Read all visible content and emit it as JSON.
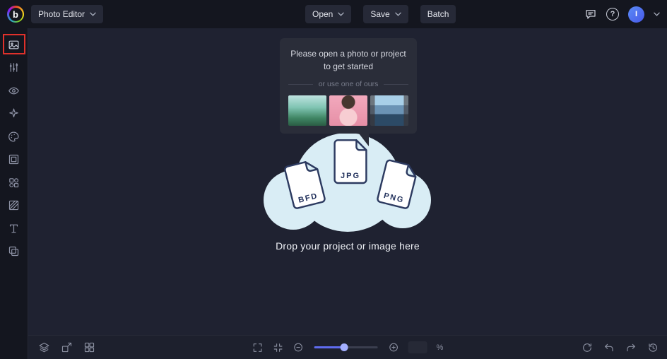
{
  "topbar": {
    "logo_letter": "b",
    "app_menu_label": "Photo Editor",
    "open_label": "Open",
    "save_label": "Save",
    "batch_label": "Batch",
    "help_glyph": "?",
    "avatar_initial": "I"
  },
  "sidebar": {
    "items": [
      {
        "icon": "image-icon"
      },
      {
        "icon": "adjust-icon"
      },
      {
        "icon": "eye-icon"
      },
      {
        "icon": "effects-icon"
      },
      {
        "icon": "palette-icon"
      },
      {
        "icon": "frame-icon"
      },
      {
        "icon": "overlays-icon"
      },
      {
        "icon": "texture-icon"
      },
      {
        "icon": "text-icon"
      },
      {
        "icon": "graphics-icon"
      }
    ]
  },
  "popover": {
    "title": "Please open a photo or project to get started",
    "divider_label": "or use one of ours",
    "thumbnails": [
      {
        "name": "van-sample-photo"
      },
      {
        "name": "portrait-sample-photo"
      },
      {
        "name": "canal-sample-photo"
      }
    ]
  },
  "dropzone": {
    "files": [
      "BFD",
      "JPG",
      "PNG"
    ],
    "caption": "Drop your project or image here"
  },
  "bottombar": {
    "zoom_value": "",
    "percent_label": "%"
  },
  "colors": {
    "topbar_bg": "#14161f",
    "canvas_bg": "#1f2231",
    "panel_bg": "#2a2d39",
    "blob_blue": "#d9edf5",
    "file_outline": "#2c3a60",
    "accent_blue": "#5f6cf0",
    "annotation_red": "#e0312b"
  }
}
